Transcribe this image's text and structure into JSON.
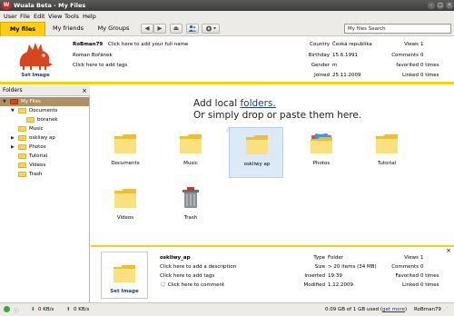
{
  "window": {
    "title": "Wuala Beta - My Files",
    "app_icon_letter": "W"
  },
  "menu": [
    "User",
    "File",
    "Edit",
    "View",
    "Tools",
    "Help"
  ],
  "tabs": [
    {
      "label": "My files",
      "active": true
    },
    {
      "label": "My friends",
      "active": false
    },
    {
      "label": "My Groups",
      "active": false
    }
  ],
  "toolbar": {
    "back_glyph": "◀",
    "forward_glyph": "▶",
    "eject_glyph": "⏏",
    "search_placeholder": "My files Search"
  },
  "profile": {
    "username": "RoBman79",
    "full_name_hint": "Click here to add your full name",
    "real_name": "Roman Bořánek",
    "tags_hint": "Click here to add tags",
    "set_image": "Set Image",
    "fields": [
      {
        "label": "Country",
        "value": "Česká republika"
      },
      {
        "label": "Birthday",
        "value": "15.6.1991"
      },
      {
        "label": "Gender",
        "value": "m"
      },
      {
        "label": "Joined",
        "value": "25.11.2009"
      }
    ],
    "stats": [
      {
        "label": "Views",
        "value": "1"
      },
      {
        "label": "Comments",
        "value": "0"
      },
      {
        "label": "favorited",
        "value": "0 times"
      },
      {
        "label": "Linked",
        "value": "0 times"
      }
    ]
  },
  "sidebar": {
    "header": "Folders",
    "tree": [
      {
        "label": "My Files",
        "level": 0,
        "twisty": "▼",
        "selected": true
      },
      {
        "label": "Documents",
        "level": 1,
        "twisty": "▼",
        "selected": false
      },
      {
        "label": "boranek",
        "level": 2,
        "twisty": "",
        "selected": false
      },
      {
        "label": "Music",
        "level": 1,
        "twisty": "",
        "selected": false
      },
      {
        "label": "oskliwy ap",
        "level": 1,
        "twisty": "▶",
        "selected": false
      },
      {
        "label": "Photos",
        "level": 1,
        "twisty": "▶",
        "selected": false
      },
      {
        "label": "Tutorial",
        "level": 1,
        "twisty": "",
        "selected": false
      },
      {
        "label": "Videos",
        "level": 1,
        "twisty": "",
        "selected": false
      },
      {
        "label": "Trash",
        "level": 1,
        "twisty": "",
        "selected": false
      }
    ]
  },
  "main": {
    "add_line1_prefix": "Add local ",
    "add_line1_link": "folders.",
    "add_line2": "Or simply drop or paste them here.",
    "items": [
      {
        "label": "Documents",
        "kind": "folder",
        "selected": false
      },
      {
        "label": "Music",
        "kind": "folder",
        "selected": false
      },
      {
        "label": "oskliwy ap",
        "kind": "folder",
        "selected": true
      },
      {
        "label": "Photos",
        "kind": "photos",
        "selected": false
      },
      {
        "label": "Tutorial",
        "kind": "folder",
        "selected": false
      },
      {
        "label": "Videos",
        "kind": "folder",
        "selected": false
      },
      {
        "label": "Trash",
        "kind": "trash",
        "selected": false
      }
    ]
  },
  "detail": {
    "name": "oskliwy_ap",
    "description_hint": "Click here to add a description",
    "tags_hint": "Click here to add tags",
    "comment_hint": "Click here to comment",
    "set_image": "Set Image",
    "fields": [
      {
        "label": "Type",
        "value": "Folder"
      },
      {
        "label": "Size",
        "value": "> 20 items (34 MB)"
      },
      {
        "label": "Inserted",
        "value": "19:39"
      },
      {
        "label": "Modified",
        "value": "1.12.2009"
      }
    ],
    "stats": [
      {
        "label": "Views",
        "value": "1"
      },
      {
        "label": "Comments",
        "value": "0"
      },
      {
        "label": "Favorited",
        "value": "0 times"
      },
      {
        "label": "Linked",
        "value": "0 times"
      }
    ]
  },
  "status": {
    "down_rate": "0 KB/s",
    "up_rate": "0 KB/s",
    "storage": "0.09 GB of 1 GB used (",
    "get_more": "get more",
    "storage_close": ")",
    "user": "RoBman79"
  },
  "colors": {
    "accent": "#f9cf0e",
    "selection": "#b08f63",
    "link": "#1e3b8a"
  }
}
